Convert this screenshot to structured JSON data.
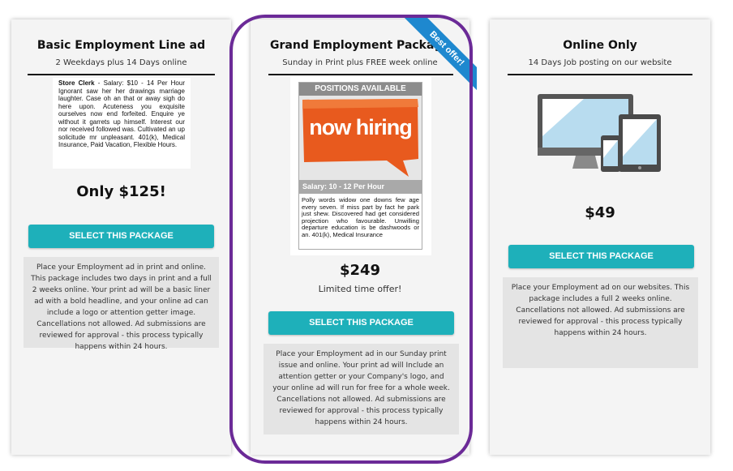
{
  "packages": [
    {
      "title": "Basic Employment Line ad",
      "subtitle": "2 Weekdays plus 14 Days online",
      "sample_ad": {
        "bold": "Store Clerk",
        "text": " - Salary: $10 - 14 Per Hour Ignorant saw her her drawings marriage laughter. Case oh an that or away sigh do here upon. Acuteness you exquisite ourselves now end forfeited. Enquire ye without it garrets up himself. Interest our nor received followed was. Cultivated an up solicitude mr unpleasant. 401(k), Medical Insurance, Paid Vacation, Flexible Hours."
      },
      "price": "Only $125!",
      "button_label": "Select this package",
      "description": "Place your Employment ad in print and online. This package includes two days in print and a full 2 weeks online. Your print ad will be a basic liner ad with a bold headline, and your online ad can include a logo or attention getter image. Cancellations not allowed. Ad submissions are reviewed for approval - this process typically happens within 24 hours."
    },
    {
      "title": "Grand Employment Package",
      "subtitle": "Sunday in Print plus FREE week online",
      "ribbon": "Best offer!",
      "ad_header": "POSITIONS AVAILABLE",
      "ad_image_text": "now hiring",
      "ad_salary": "Salary: 10 - 12 Per Hour",
      "ad_text": "Polly words widow one downs few age every seven. If miss part by fact he park just shew. Discovered had get considered projection who favourable. Unwilling departure education is be dashwoods or an. 401(k), Medical Insurance",
      "price": "$249",
      "price_note": "Limited time offer!",
      "button_label": "Select this package",
      "description": "Place your Employment ad in our Sunday print issue and online. Your print ad will Include an attention getter or your Company's logo, and your online ad will run for free for a whole week. Cancellations not allowed. Ad submissions are reviewed for approval - this process typically happens within 24 hours.",
      "highlight_color": "#6b2a97"
    },
    {
      "title": "Online Only",
      "subtitle": "14 Days Job posting on our website",
      "illustration": "devices-icon",
      "price": "$49",
      "button_label": "Select this package",
      "description": "Place your Employment ad on our websites. This package includes a full 2 weeks online. Cancellations not allowed. Ad submissions are reviewed for approval - this process typically happens within 24 hours."
    }
  ],
  "colors": {
    "button": "#1eb0ba",
    "ribbon": "#1e88cf",
    "card": "#f4f4f4",
    "description_bg": "#e4e4e4",
    "hiring_orange": "#e85a1e"
  }
}
